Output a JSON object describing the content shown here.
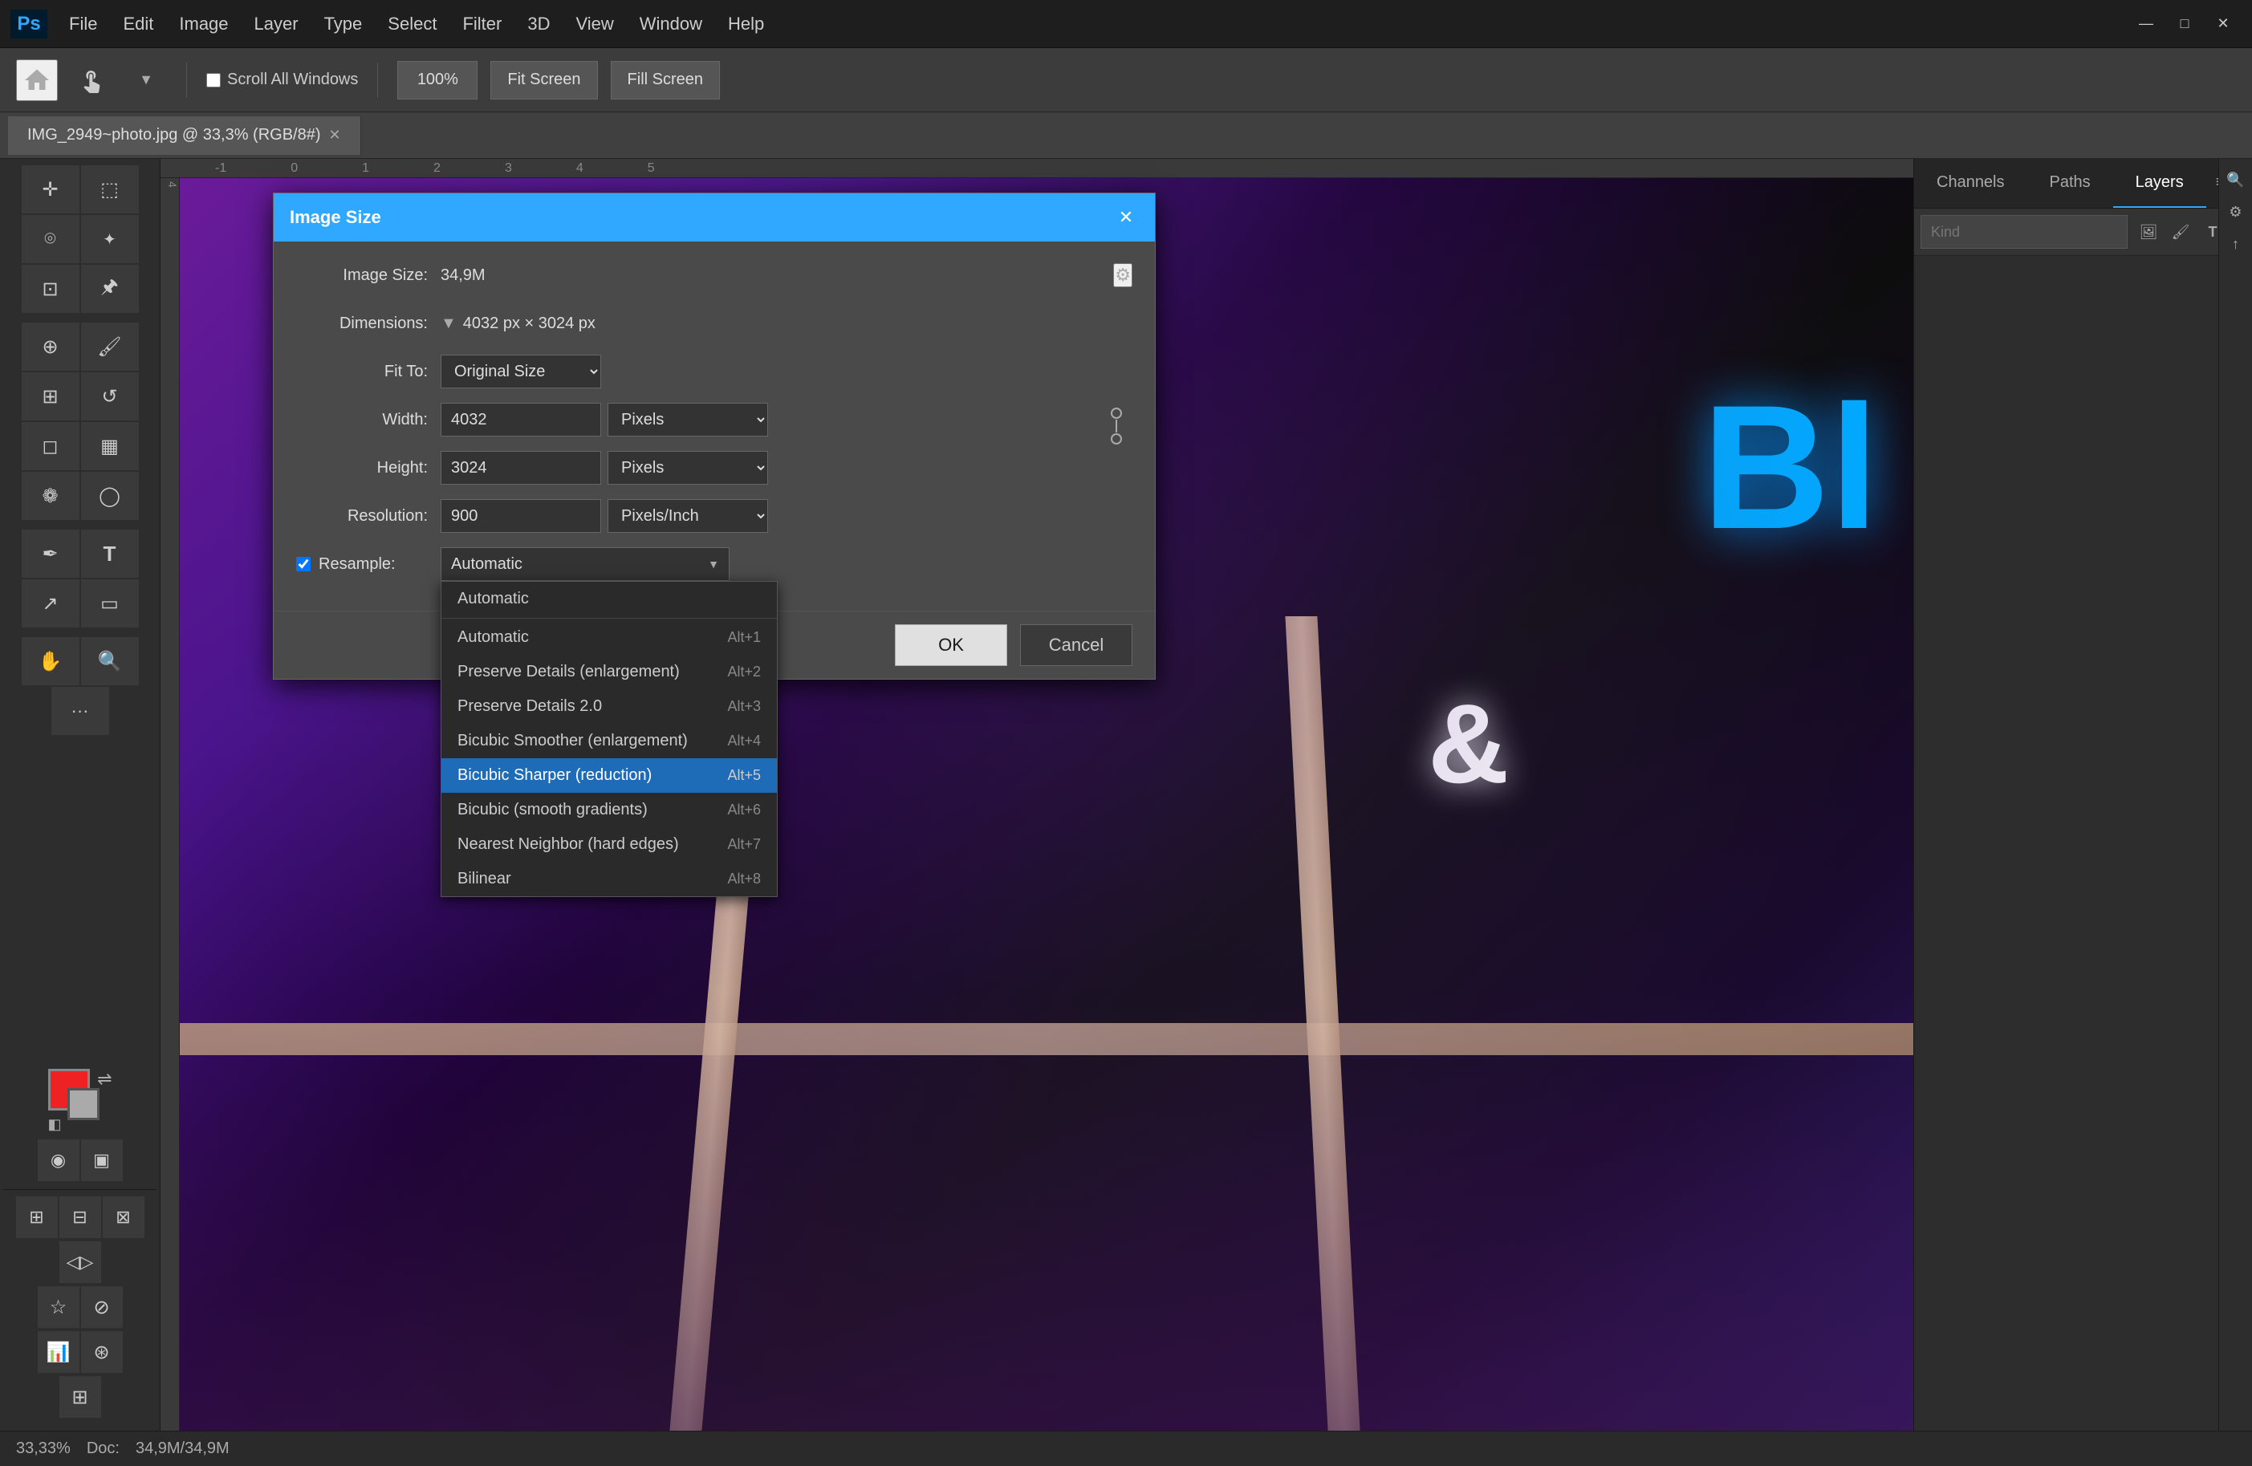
{
  "app": {
    "title": "Adobe Photoshop",
    "logo": "Ps"
  },
  "titlebar": {
    "menu_items": [
      "File",
      "Edit",
      "Image",
      "Layer",
      "Type",
      "Select",
      "Filter",
      "3D",
      "View",
      "Window",
      "Help"
    ],
    "controls": [
      "minimize",
      "maximize",
      "close"
    ]
  },
  "options_bar": {
    "scroll_all_windows_label": "Scroll All Windows",
    "zoom_level": "100%",
    "fit_screen_label": "Fit Screen",
    "fill_screen_label": "Fill Screen"
  },
  "tab": {
    "filename": "IMG_2949~photo.jpg @ 33,3% (RGB/8#)"
  },
  "left_panel": {
    "tools": [
      {
        "name": "move-tool",
        "icon": "✛"
      },
      {
        "name": "marquee-tool",
        "icon": "⬚"
      },
      {
        "name": "lasso-tool",
        "icon": "⌾"
      },
      {
        "name": "quick-select-tool",
        "icon": "✦"
      },
      {
        "name": "crop-tool",
        "icon": "⊡"
      },
      {
        "name": "eyedropper-tool",
        "icon": "💉"
      },
      {
        "name": "spot-heal-tool",
        "icon": "🩹"
      },
      {
        "name": "brush-tool",
        "icon": "🖌"
      },
      {
        "name": "clone-tool",
        "icon": "✍"
      },
      {
        "name": "history-brush-tool",
        "icon": "↺"
      },
      {
        "name": "eraser-tool",
        "icon": "◻"
      },
      {
        "name": "gradient-tool",
        "icon": "▦"
      },
      {
        "name": "blur-tool",
        "icon": "❁"
      },
      {
        "name": "dodge-tool",
        "icon": "◯"
      },
      {
        "name": "pen-tool",
        "icon": "🖊"
      },
      {
        "name": "text-tool",
        "icon": "T"
      },
      {
        "name": "path-select-tool",
        "icon": "↗"
      },
      {
        "name": "shape-tool",
        "icon": "▭"
      },
      {
        "name": "hand-tool",
        "icon": "✋"
      },
      {
        "name": "zoom-tool",
        "icon": "🔍"
      },
      {
        "name": "more-tools",
        "icon": "···"
      }
    ],
    "fg_color": "#e22222",
    "bg_color": "#aaaaaa"
  },
  "right_panel": {
    "tabs": [
      "Channels",
      "Paths",
      "Layers"
    ],
    "active_tab": "Layers",
    "search_placeholder": "Kind",
    "panel_icons": [
      "image-icon",
      "brush-icon",
      "type-icon",
      "shape-icon",
      "lock-icon"
    ]
  },
  "status_bar": {
    "zoom": "33,33%",
    "doc_label": "Doc:",
    "doc_size": "34,9M/34,9M"
  },
  "image_size_dialog": {
    "title": "Image Size",
    "image_size_label": "Image Size:",
    "image_size_value": "34,9M",
    "dimensions_label": "Dimensions:",
    "dimensions_value": "4032 px × 3024 px",
    "fit_to_label": "Fit To:",
    "fit_to_value": "Original Size",
    "width_label": "Width:",
    "width_value": "4032",
    "width_unit": "Pixels",
    "height_label": "Height:",
    "height_value": "3024",
    "height_unit": "Pixels",
    "resolution_label": "Resolution:",
    "resolution_value": "900",
    "resolution_unit": "Pixels/Inch",
    "resample_label": "Resample:",
    "resample_checked": true,
    "resample_options": [
      {
        "label": "Automatic",
        "shortcut": ""
      },
      {
        "label": "Automatic",
        "shortcut": "Alt+1"
      },
      {
        "label": "Preserve Details (enlargement)",
        "shortcut": "Alt+2"
      },
      {
        "label": "Preserve Details 2.0",
        "shortcut": "Alt+3"
      },
      {
        "label": "Bicubic Smoother (enlargement)",
        "shortcut": "Alt+4"
      },
      {
        "label": "Bicubic Sharper (reduction)",
        "shortcut": "Alt+5"
      },
      {
        "label": "Bicubic (smooth gradients)",
        "shortcut": "Alt+6"
      },
      {
        "label": "Nearest Neighbor (hard edges)",
        "shortcut": "Alt+7"
      },
      {
        "label": "Bilinear",
        "shortcut": "Alt+8"
      }
    ],
    "resample_selected": "Automatic",
    "resample_highlighted": "Bicubic Sharper (reduction)",
    "ok_label": "OK",
    "cancel_label": "Cancel"
  }
}
